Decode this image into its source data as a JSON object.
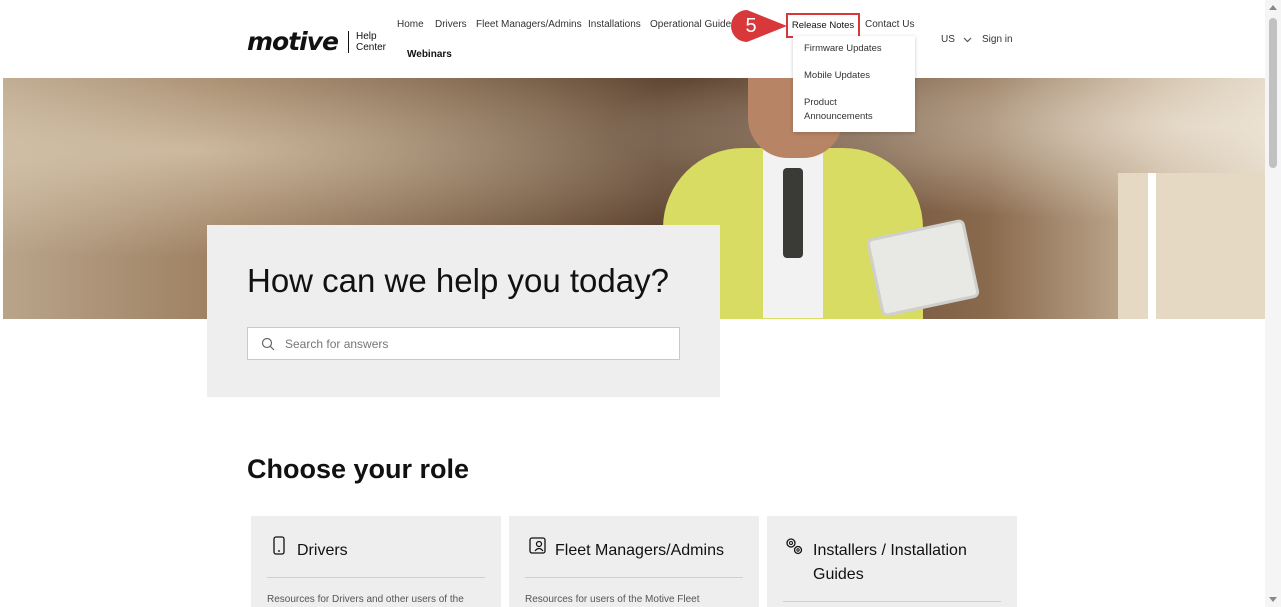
{
  "logo": {
    "wordmark": "motive",
    "sub_line1": "Help",
    "sub_line2": "Center"
  },
  "nav": {
    "items": [
      "Home",
      "Drivers",
      "Fleet Managers/Admins",
      "Installations",
      "Operational Guides"
    ],
    "second_row": "Webinars",
    "release_notes": "Release Notes",
    "contact": "Contact Us",
    "locale": "US",
    "signin": "Sign in"
  },
  "annotation": {
    "step": "5",
    "color": "#d9383a"
  },
  "dropdown": {
    "items": [
      "Firmware Updates",
      "Mobile Updates",
      "Product",
      "Announcements"
    ]
  },
  "hero": {
    "title": "How can we help you today?",
    "search_placeholder": "Search for answers"
  },
  "roles": {
    "title": "Choose your role",
    "cards": [
      {
        "icon": "phone-icon",
        "title": "Drivers",
        "desc": "Resources for Drivers and other users of the"
      },
      {
        "icon": "tablet-person-icon",
        "title": "Fleet Managers/Admins",
        "desc": "Resources for users of the Motive Fleet"
      },
      {
        "icon": "gears-icon",
        "title_line1": "Installers / Installation",
        "title_line2": "Guides",
        "desc": ""
      }
    ]
  }
}
